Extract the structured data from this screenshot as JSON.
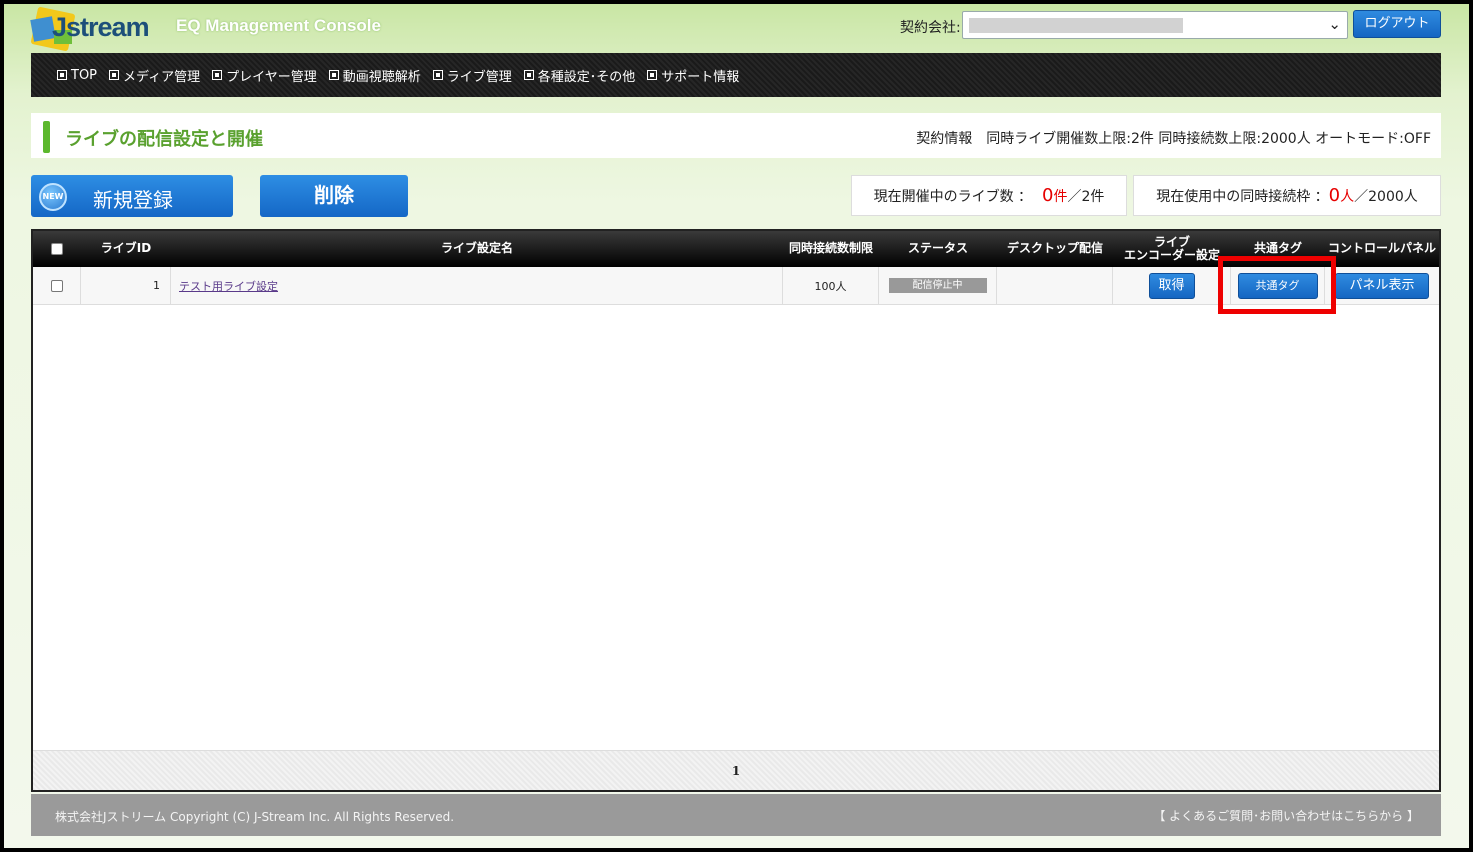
{
  "header": {
    "logo_text": "Jstream",
    "app_title": "EQ Management Console",
    "company_label": "契約会社:",
    "logout_label": "ログアウト"
  },
  "nav": {
    "items": [
      "TOP",
      "メディア管理",
      "プレイヤー管理",
      "動画視聴解析",
      "ライブ管理",
      "各種設定･その他",
      "サポート情報"
    ]
  },
  "page": {
    "title": "ライブの配信設定と開催",
    "contract_info": "契約情報　同時ライブ開催数上限:2件  同時接続数上限:2000人  オートモード:OFF"
  },
  "actions": {
    "new_icon_text": "NEW",
    "new_label": "新規登録",
    "delete_label": "削除"
  },
  "stats": {
    "live_label": "現在開催中のライブ数 ：",
    "live_count": "0",
    "live_unit": "件",
    "live_limit": "／2件",
    "conn_label": "現在使用中の同時接続枠 ：",
    "conn_count": "0",
    "conn_unit": "人",
    "conn_limit": "／2000人"
  },
  "table": {
    "headers": {
      "live_id": "ライブID",
      "name": "ライブ設定名",
      "limit": "同時接続数制限",
      "status": "ステータス",
      "desktop": "デスクトップ配信",
      "encoder_line1": "ライブ",
      "encoder_line2": "エンコーダー設定",
      "tag": "共通タグ",
      "panel": "コントロールパネル"
    },
    "rows": [
      {
        "id": "1",
        "name": "テスト用ライブ設定",
        "limit": "100人",
        "status": "配信停止中",
        "desktop": "",
        "encoder_btn": "取得",
        "tag_btn": "共通タグ",
        "panel_btn": "パネル表示"
      }
    ],
    "page_number": "1"
  },
  "footer": {
    "copyright": "株式会社Jストリーム  Copyright (C) J-Stream Inc. All Rights Reserved.",
    "faq_link": "【 よくあるご質問･お問い合わせはこちらから 】"
  },
  "colors": {
    "accent_green": "#5cb82d",
    "button_blue": "#1a72d0",
    "highlight_red": "#ee0000",
    "count_red": "#e60000"
  }
}
